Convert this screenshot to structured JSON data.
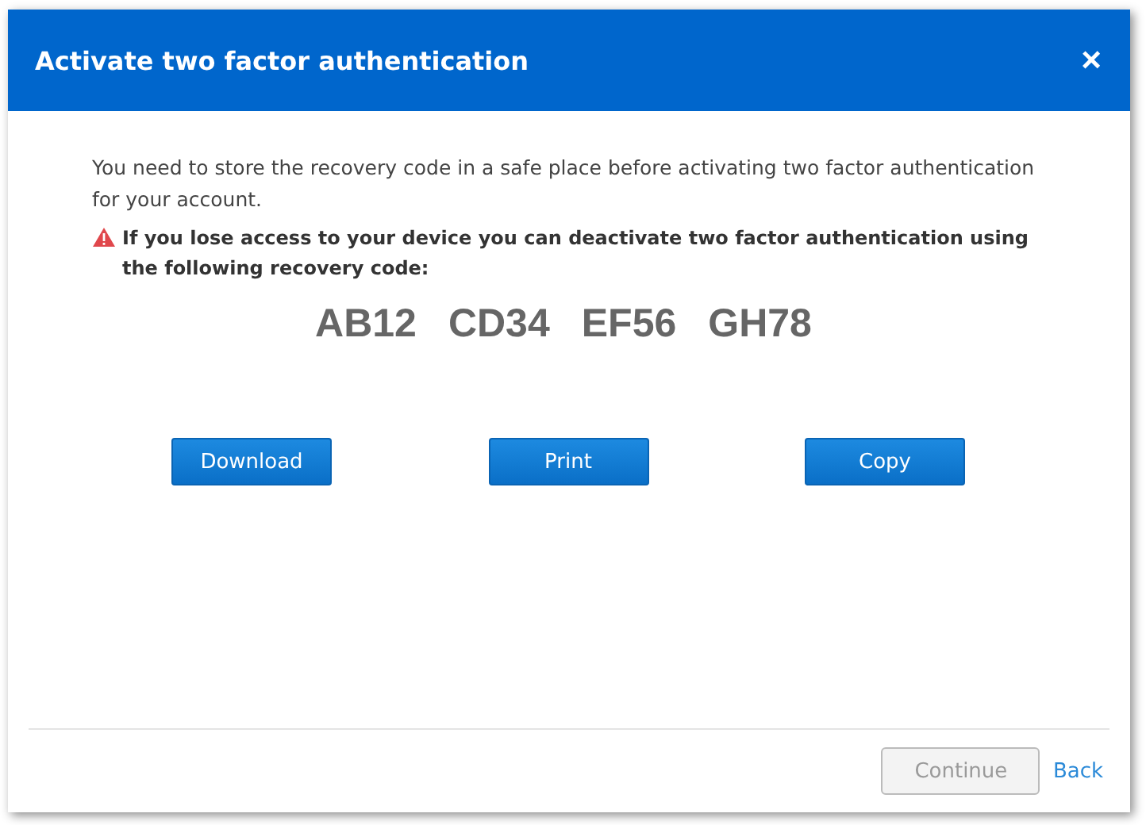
{
  "dialog": {
    "title": "Activate two factor authentication",
    "close": "×"
  },
  "intro": "You need to store the recovery code in a safe place before activating two factor authentication for your account.",
  "warning": "If you lose access to your device you can deactivate two factor authentication using the following recovery code:",
  "recovery_code": [
    "AB12",
    "CD34",
    "EF56",
    "GH78"
  ],
  "actions": [
    "Download",
    "Print",
    "Copy"
  ],
  "footer": {
    "continue": {
      "label": "Continue",
      "disabled": true
    },
    "back": "Back"
  }
}
